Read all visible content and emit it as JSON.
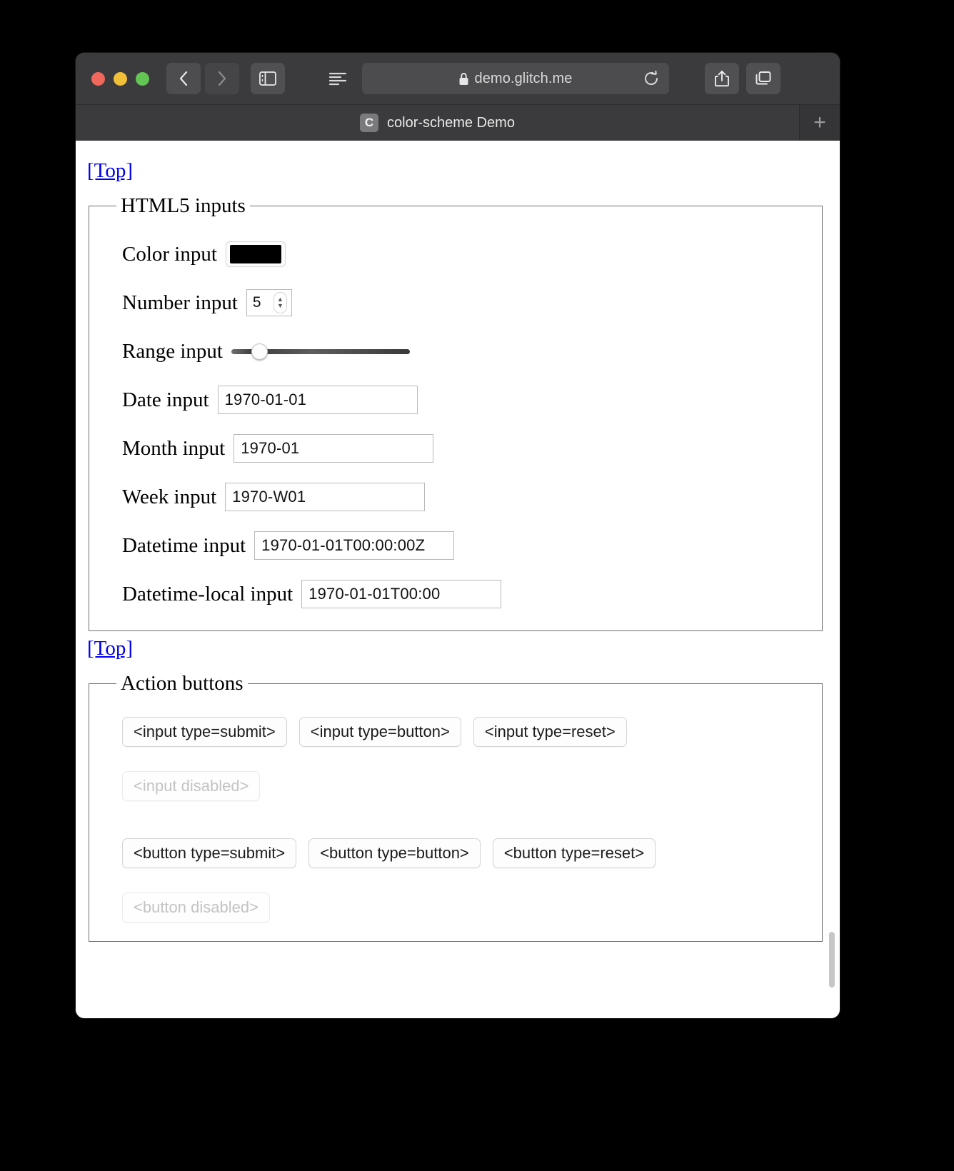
{
  "browser": {
    "window_controls": [
      "close",
      "minimize",
      "maximize"
    ],
    "nav": {
      "back_label": "‹",
      "forward_label": "›"
    },
    "url": "demo.glitch.me",
    "lock_icon": "lock-icon",
    "reload_icon": "reload-icon",
    "sidebar_icon": "sidebar-icon",
    "reader_icon": "reader-view-icon",
    "share_icon": "share-icon",
    "tabs_overview_icon": "tab-overview-icon",
    "new_tab_label": "+",
    "tab": {
      "favicon_letter": "C",
      "title": "color-scheme Demo"
    }
  },
  "page": {
    "top_link_1": "[Top]",
    "top_link_2": "[Top]",
    "fieldsets": [
      {
        "legend": "HTML5 inputs",
        "fields": [
          {
            "label": "Color input",
            "type": "color",
            "value": "#000000"
          },
          {
            "label": "Number input",
            "type": "number",
            "value": "5"
          },
          {
            "label": "Range input",
            "type": "range",
            "value": "10"
          },
          {
            "label": "Date input",
            "type": "date",
            "value": "1970-01-01"
          },
          {
            "label": "Month input",
            "type": "month",
            "value": "1970-01"
          },
          {
            "label": "Week input",
            "type": "week",
            "value": "1970-W01"
          },
          {
            "label": "Datetime input",
            "type": "datetime",
            "value": "1970-01-01T00:00:00Z"
          },
          {
            "label": "Datetime-local input",
            "type": "datetime-local",
            "value": "1970-01-01T00:00"
          }
        ]
      },
      {
        "legend": "Action buttons",
        "inputs_row": [
          "<input type=submit>",
          "<input type=button>",
          "<input type=reset>",
          "<input disabled>"
        ],
        "buttons_row": [
          "<button type=submit>",
          "<button type=button>",
          "<button type=reset>",
          "<button disabled>"
        ]
      }
    ]
  },
  "colors": {
    "link": "#0000ee",
    "chrome_bg": "#3b3b3d",
    "page_bg": "#ffffff",
    "color_swatch": "#000000"
  }
}
